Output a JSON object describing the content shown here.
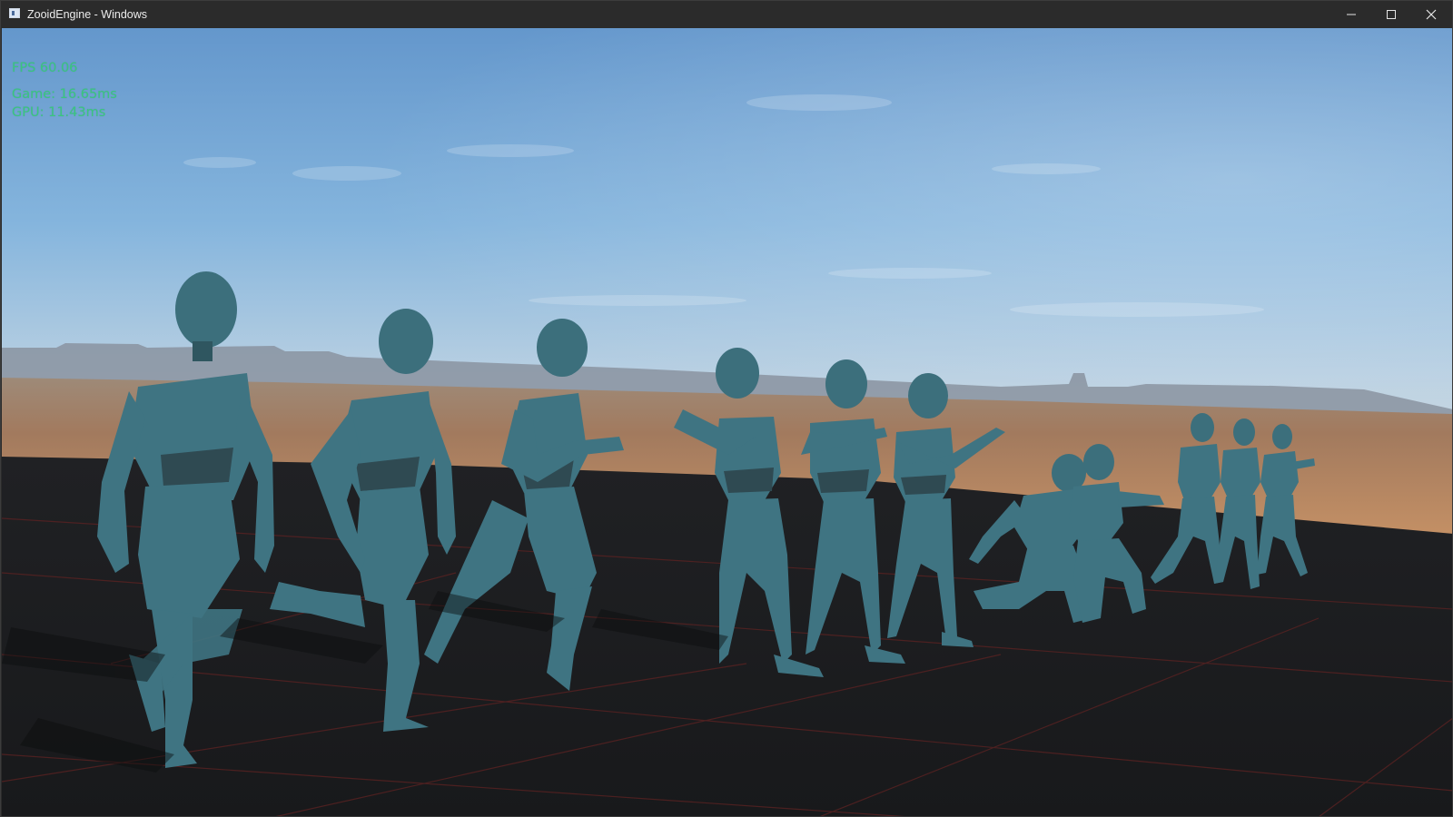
{
  "window": {
    "title": "ZooidEngine - Windows",
    "controls": [
      "minimize",
      "maximize",
      "close"
    ]
  },
  "overlay": {
    "fps": "FPS 60.06",
    "game": "Game: 16.65ms",
    "gpu": "GPU: 11.43ms"
  },
  "colors": {
    "overlay_text": "#39c77e",
    "character": "#3f7482",
    "floor": "#1c1d20",
    "floor_grid": "#4a2222",
    "sky_top": "#6a9dd0",
    "sky_horizon": "#c6d6e2"
  }
}
